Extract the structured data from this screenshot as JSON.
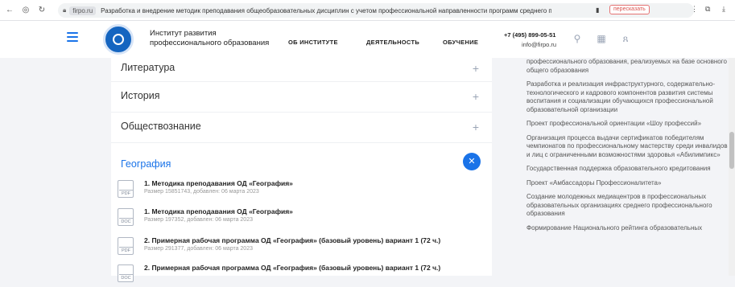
{
  "browser": {
    "domain": "firpo.ru",
    "url_text": "Разработка и внедрение методик преподавания общеобразовательных дисциплин с учетом профессиональной направленности программ среднего профессионального об...",
    "translate_label": "пересказать"
  },
  "header": {
    "org_line1": "Институт развития",
    "org_line2": "профессионального образования",
    "menu": [
      "ОБ ИНСТИТУТЕ",
      "ДЕЯТЕЛЬНОСТЬ",
      "ОБУЧЕНИЕ"
    ],
    "phone": "+7 (495) 899-05-51",
    "email": "info@firpo.ru"
  },
  "accordion": {
    "items": [
      {
        "title": "Литература",
        "icon": "plus-icon"
      },
      {
        "title": "История",
        "icon": "plus-icon"
      },
      {
        "title": "Обществознание",
        "icon": "plus-icon"
      }
    ],
    "open_title": "География",
    "close_icon": "close-icon",
    "documents": [
      {
        "ext": "PDF",
        "title": "1. Методика преподавания ОД «География»",
        "meta": "Размер 15851743, добавлен: 06 марта 2023"
      },
      {
        "ext": "DOC",
        "title": "1. Методика преподавания ОД «География»",
        "meta": "Размер 197352, добавлен: 06 марта 2023"
      },
      {
        "ext": "PDF",
        "title": "2. Примерная рабочая программа ОД «География» (базовый уровень) вариант 1 (72 ч.)",
        "meta": "Размер 291377, добавлен: 06 марта 2023"
      },
      {
        "ext": "DOC",
        "title": "2. Примерная рабочая программа ОД «География» (базовый уровень) вариант 1 (72 ч.)",
        "meta": ""
      }
    ]
  },
  "sidebar": {
    "links": [
      "профессионального образования, реализуемых на базе основного общего образования",
      "Разработка и реализация инфраструктурного, содержательно-технологического и кадрового компонентов развития системы воспитания и социализации обучающихся профессиональной образовательной организации",
      "Проект профессиональной ориентации «Шоу профессий»",
      "Организация процесса выдачи сертификатов победителям чемпионатов по профессиональному мастерству среди инвалидов и лиц с ограниченными возможностями здоровья «Абилимпикс»",
      "Государственная поддержка образовательного кредитования",
      "Проект «Амбассадоры Профессионалитета»",
      "Создание молодежных медиацентров в профессиональных образовательных организациях среднего профессионального образования",
      "Формирование Национального рейтинга образовательных"
    ]
  },
  "colors": {
    "accent": "#1a73e8"
  }
}
